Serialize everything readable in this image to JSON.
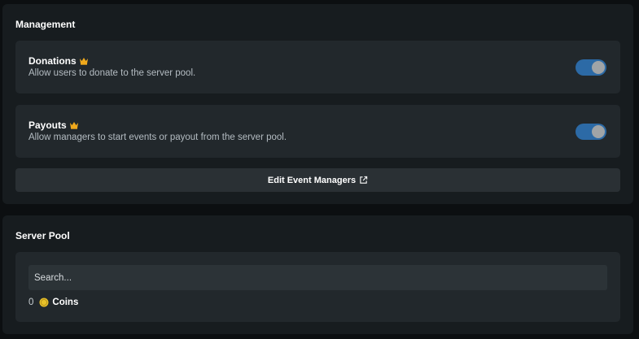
{
  "management": {
    "title": "Management",
    "donations": {
      "title": "Donations",
      "description": "Allow users to donate to the server pool.",
      "enabled": true,
      "icon": "crown-icon"
    },
    "payouts": {
      "title": "Payouts",
      "description": "Allow managers to start events or payout from the server pool.",
      "enabled": true,
      "icon": "crown-icon"
    },
    "edit_managers_label": "Edit Event Managers",
    "edit_managers_icon": "external-link-icon"
  },
  "server_pool": {
    "title": "Server Pool",
    "search_placeholder": "Search...",
    "coins_amount": "0",
    "coins_label": "Coins",
    "coins_icon": "coin-icon"
  },
  "colors": {
    "accent_toggle": "#2c6aa6",
    "crown": "#f0a91c",
    "coin": "#e8c22a"
  }
}
